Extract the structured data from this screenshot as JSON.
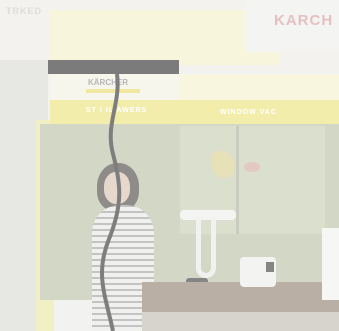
{
  "scene": {
    "corner_text": "ŦṚKED",
    "store_brand": "KARCH",
    "shelf_brand": "KÄRCHER",
    "fixture_label_left": "ST  I IL AWERS",
    "fixture_label_right": "WINDOW VAC"
  },
  "colors": {
    "accent_yellow": "#ece37a",
    "shelf_black": "#2b2b2b",
    "panel_grey": "#9aa08e",
    "photo_wall": "#c6cbb0"
  }
}
